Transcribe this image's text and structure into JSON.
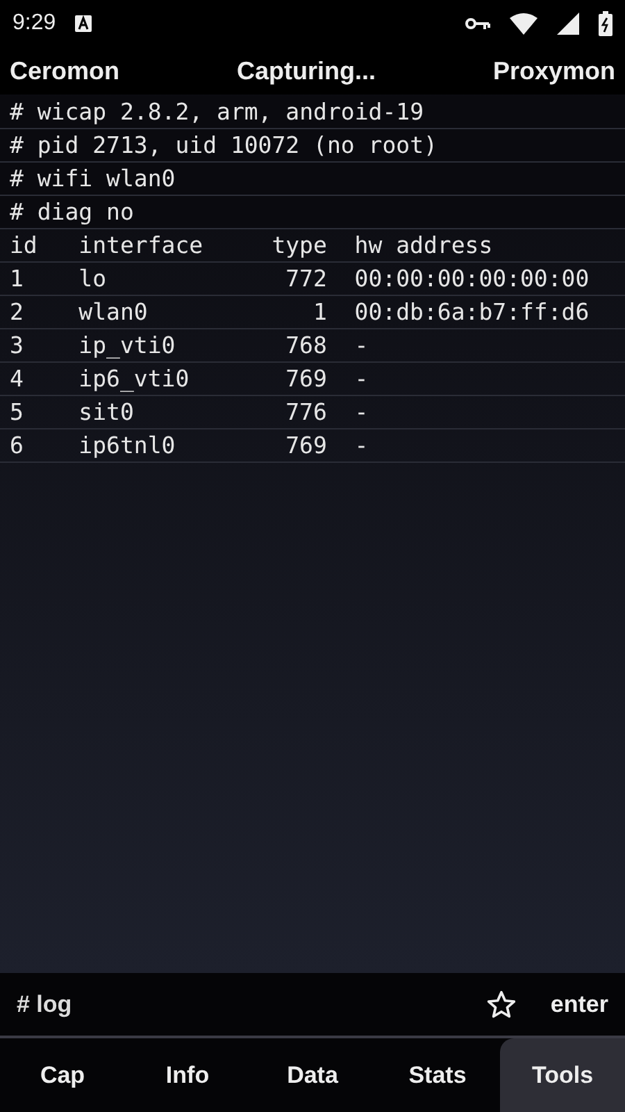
{
  "status_bar": {
    "time": "9:29"
  },
  "header": {
    "left": "Ceromon",
    "center": "Capturing...",
    "right": "Proxymon"
  },
  "log_lines": [
    "# wicap 2.8.2, arm, android-19",
    "# pid 2713, uid 10072 (no root)",
    "# wifi wlan0",
    "# diag no"
  ],
  "table": {
    "columns": [
      "id",
      "interface",
      "type",
      "hw address"
    ],
    "rows": [
      [
        "1",
        "lo",
        "772",
        "00:00:00:00:00:00"
      ],
      [
        "2",
        "wlan0",
        "1",
        "00:db:6a:b7:ff:d6"
      ],
      [
        "3",
        "ip_vti0",
        "768",
        "-"
      ],
      [
        "4",
        "ip6_vti0",
        "769",
        "-"
      ],
      [
        "5",
        "sit0",
        "776",
        "-"
      ],
      [
        "6",
        "ip6tnl0",
        "769",
        "-"
      ]
    ]
  },
  "command_bar": {
    "placeholder": "# log",
    "favorite": false,
    "action": "enter"
  },
  "tabs": [
    {
      "label": "Cap",
      "selected": false
    },
    {
      "label": "Info",
      "selected": false
    },
    {
      "label": "Data",
      "selected": false
    },
    {
      "label": "Stats",
      "selected": false
    },
    {
      "label": "Tools",
      "selected": true
    }
  ]
}
